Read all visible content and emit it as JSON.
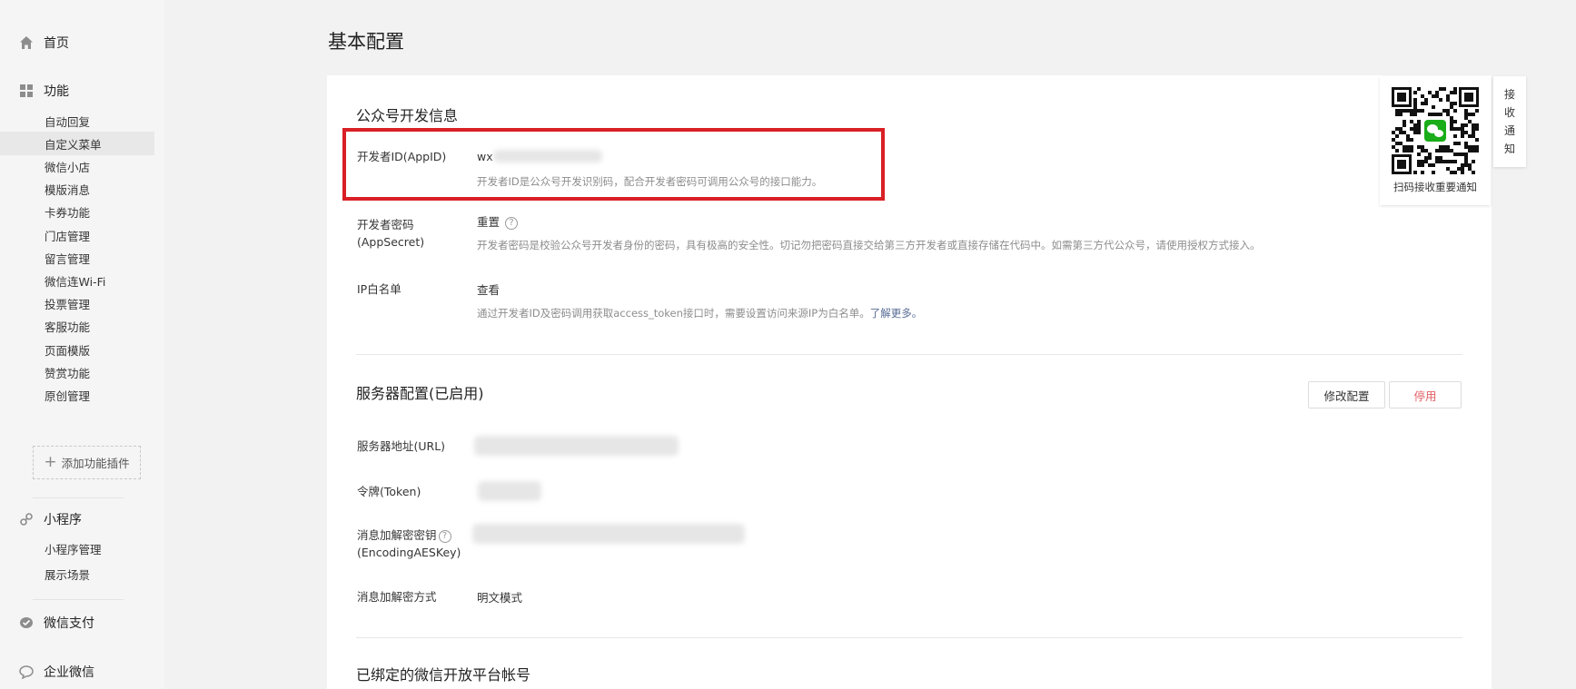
{
  "sidebar": {
    "home": {
      "label": "首页",
      "icon": "home-icon"
    },
    "features": {
      "label": "功能",
      "icon": "grid-icon",
      "items": [
        "自动回复",
        "自定义菜单",
        "微信小店",
        "模版消息",
        "卡券功能",
        "门店管理",
        "留言管理",
        "微信连Wi-Fi",
        "投票管理",
        "客服功能",
        "页面模版",
        "赞赏功能",
        "原创管理"
      ],
      "active_index": 1,
      "add_plugin": "添加功能插件"
    },
    "miniprogram": {
      "label": "小程序",
      "icon": "link-icon",
      "items": [
        "小程序管理",
        "展示场景"
      ]
    },
    "pay": {
      "label": "微信支付",
      "icon": "wechat-pay-icon"
    },
    "work": {
      "label": "企业微信",
      "icon": "chat-bubble-icon"
    }
  },
  "page_title": "基本配置",
  "dev_info": {
    "title": "公众号开发信息",
    "appid": {
      "label": "开发者ID(AppID)",
      "value_prefix": "wx",
      "desc": "开发者ID是公众号开发识别码，配合开发者密码可调用公众号的接口能力。"
    },
    "secret": {
      "label_line1": "开发者密码",
      "label_line2": "(AppSecret)",
      "action": "重置",
      "desc": "开发者密码是校验公众号开发者身份的密码，具有极高的安全性。切记勿把密码直接交给第三方开发者或直接存储在代码中。如需第三方代公众号，请使用授权方式接入。"
    },
    "ip_whitelist": {
      "label": "IP白名单",
      "action": "查看",
      "desc": "通过开发者ID及密码调用获取access_token接口时，需要设置访问来源IP为白名单。",
      "desc_link": "了解更多。"
    }
  },
  "server_config": {
    "title": "服务器配置(已启用)",
    "modify_button": "修改配置",
    "stop_button": "停用",
    "url_label": "服务器地址(URL)",
    "token_label": "令牌(Token)",
    "aes_label_line1": "消息加解密密钥",
    "aes_label_line2": "(EncodingAESKey)",
    "mode_label": "消息加解密方式",
    "mode_value": "明文模式"
  },
  "bound_platform": {
    "title": "已绑定的微信开放平台帐号"
  },
  "qr": {
    "caption": "扫码接收重要通知",
    "tab_chars": [
      "接",
      "收",
      "通",
      "知"
    ]
  },
  "colors": {
    "highlight_border": "#d92026",
    "link": "#576b95",
    "danger": "#e15f63",
    "wechat_green": "#1aad19"
  }
}
